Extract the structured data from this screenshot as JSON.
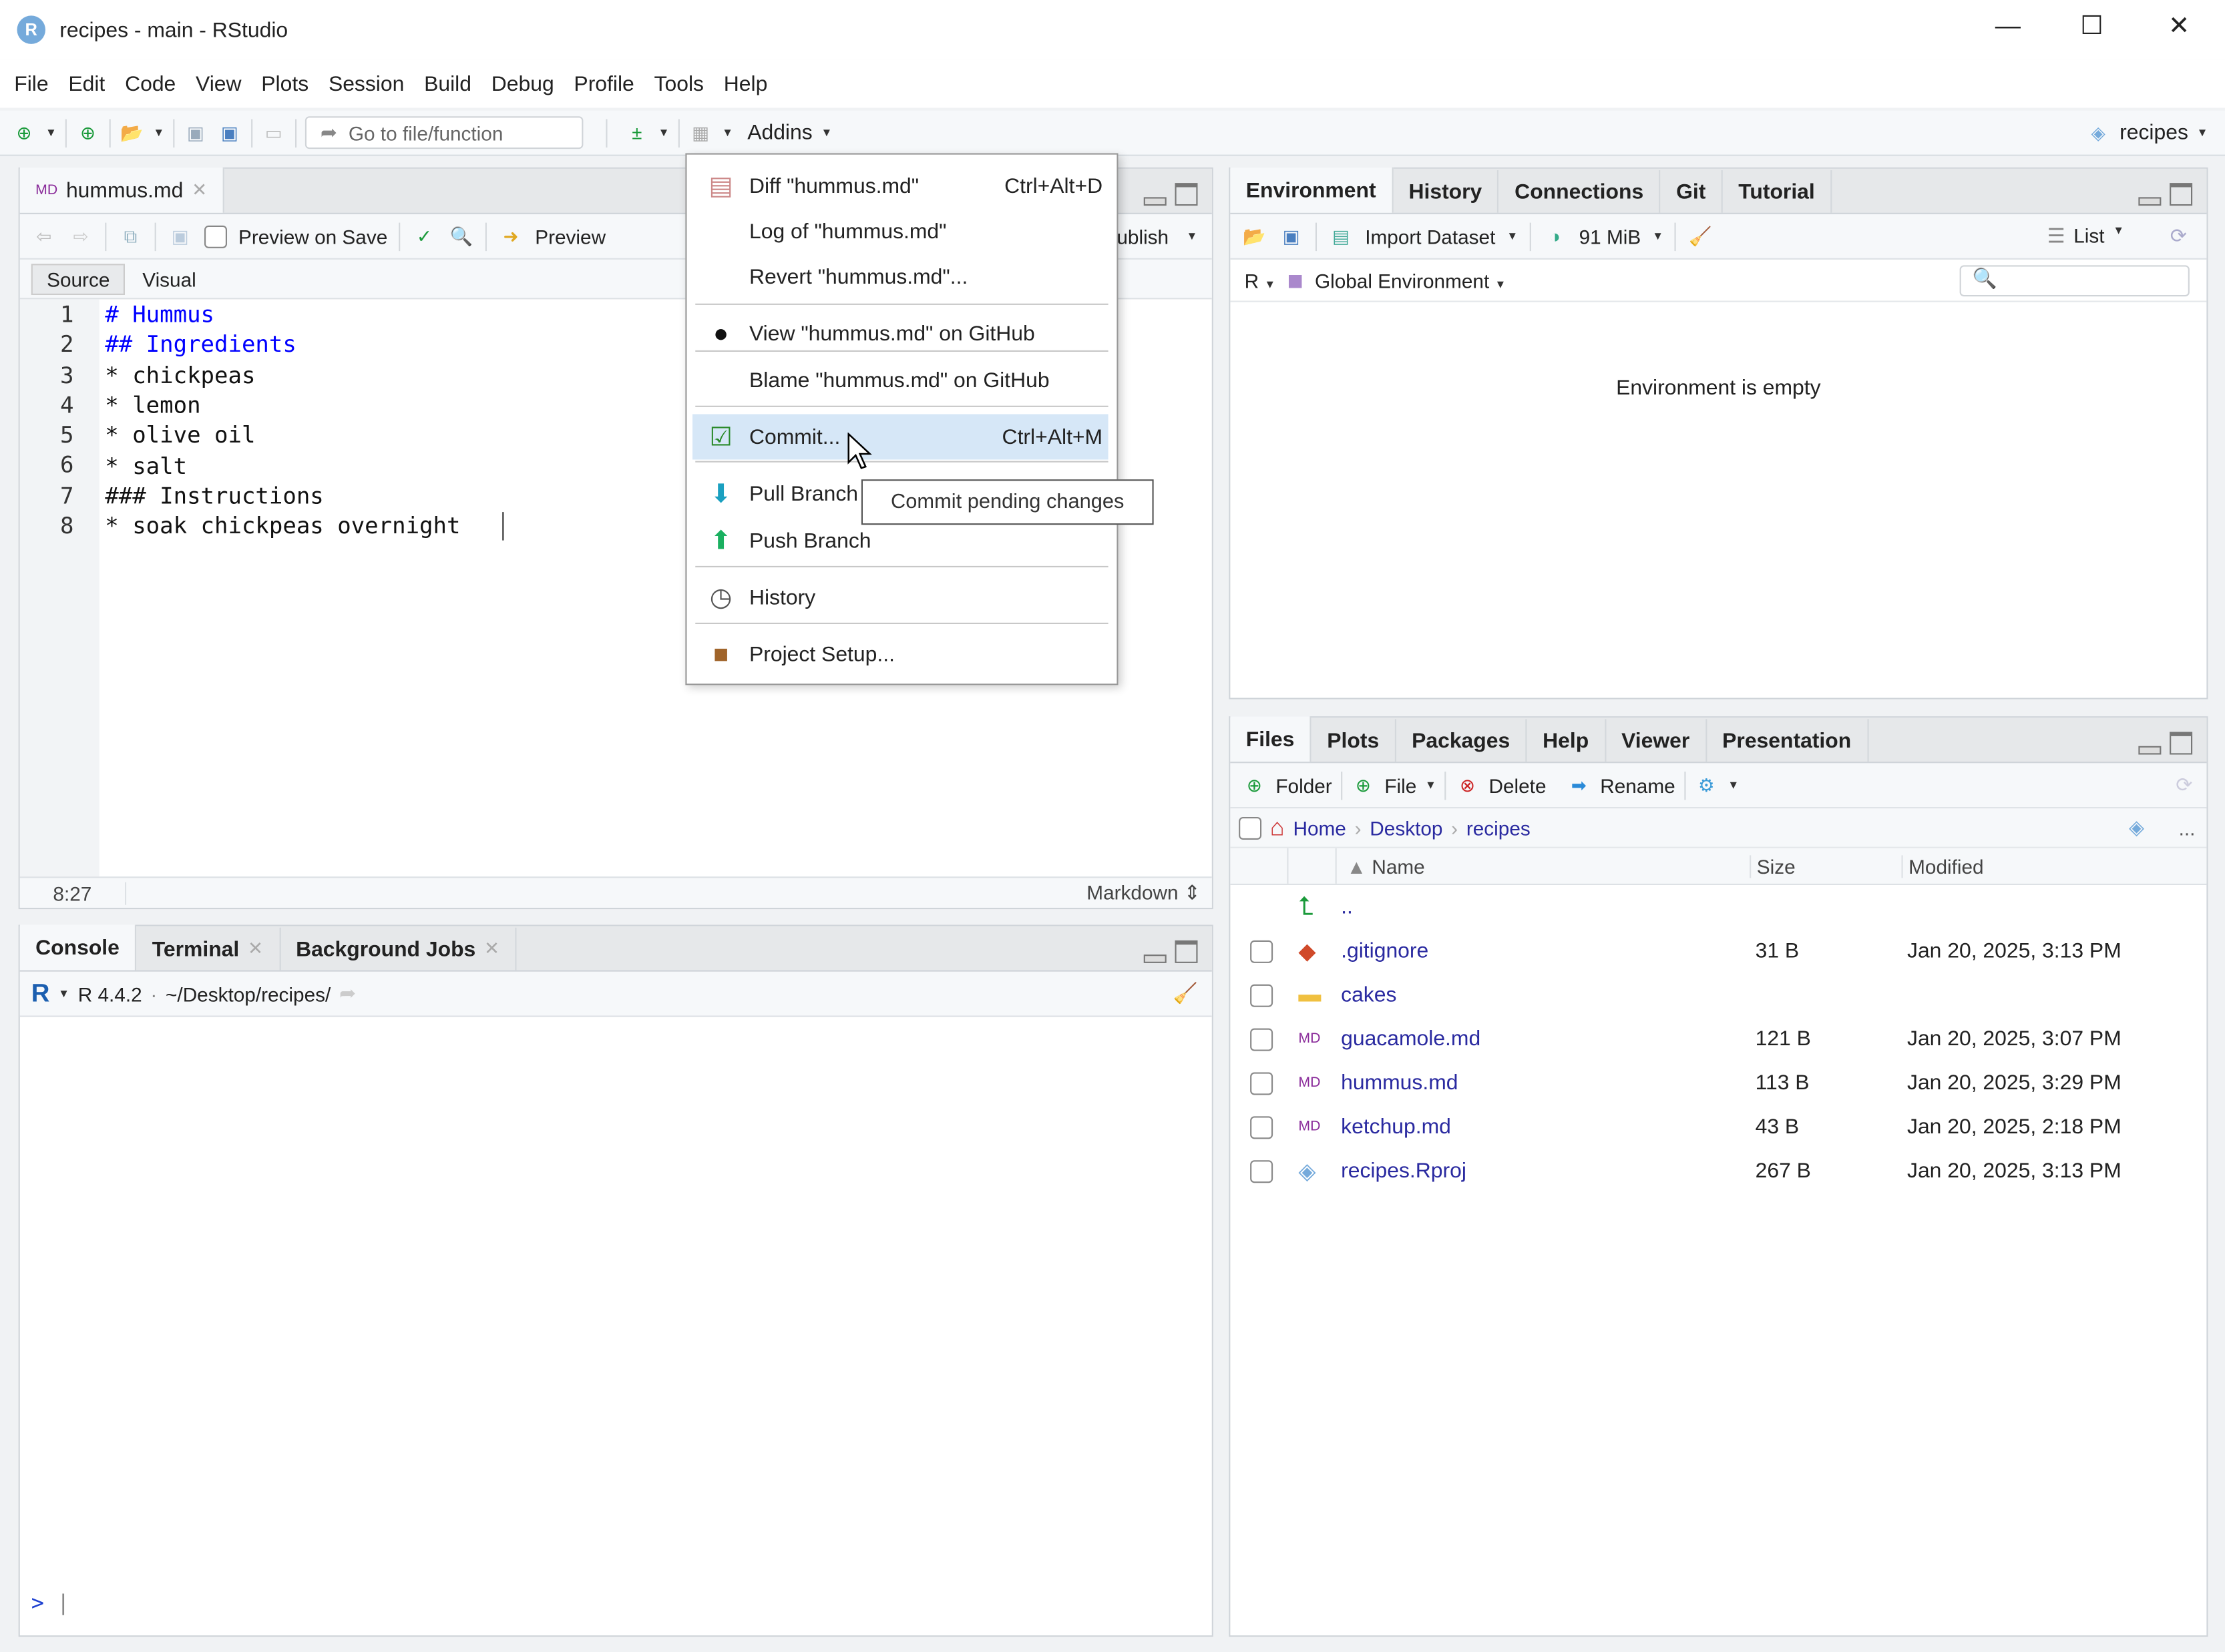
{
  "window": {
    "title": "recipes - main - RStudio",
    "minimize": "—",
    "maximize": "☐",
    "close": "✕"
  },
  "menubar": [
    "File",
    "Edit",
    "Code",
    "View",
    "Plots",
    "Session",
    "Build",
    "Debug",
    "Profile",
    "Tools",
    "Help"
  ],
  "toolbar": {
    "goto_placeholder": "Go to file/function",
    "addins": "Addins",
    "project": "recipes"
  },
  "editor": {
    "tab": "hummus.md",
    "preview_on_save": "Preview on Save",
    "preview": "Preview",
    "publish": "ublish",
    "source": "Source",
    "visual": "Visual",
    "lines": [
      {
        "n": "1",
        "t": "# Hummus",
        "h": true
      },
      {
        "n": "2",
        "t": "## Ingredients",
        "h": true
      },
      {
        "n": "3",
        "t": "* chickpeas"
      },
      {
        "n": "4",
        "t": "* lemon"
      },
      {
        "n": "5",
        "t": "* olive oil"
      },
      {
        "n": "6",
        "t": "* salt"
      },
      {
        "n": "7",
        "t": "### Instructions"
      },
      {
        "n": "8",
        "t": "* soak chickpeas overnight"
      }
    ],
    "position": "8:27",
    "mode": "Markdown"
  },
  "git_menu": {
    "items": [
      {
        "label": "Diff \"hummus.md\"",
        "shortcut": "Ctrl+Alt+D",
        "icon": "diff-icon"
      },
      {
        "label": "Log of \"hummus.md\"",
        "shortcut": "",
        "icon": ""
      },
      {
        "label": "Revert \"hummus.md\"...",
        "shortcut": "",
        "icon": ""
      },
      {
        "label": "View \"hummus.md\" on GitHub",
        "shortcut": "",
        "icon": "github-icon"
      },
      {
        "label": "Blame \"hummus.md\" on GitHub",
        "shortcut": "",
        "icon": ""
      },
      {
        "label": "Commit...",
        "shortcut": "Ctrl+Alt+M",
        "icon": "commit-icon",
        "highlighted": true
      },
      {
        "label": "Pull Branch",
        "shortcut": "",
        "icon": "pull-arrow-icon"
      },
      {
        "label": "Push Branch",
        "shortcut": "",
        "icon": "push-arrow-icon"
      },
      {
        "label": "History",
        "shortcut": "",
        "icon": "clock-icon"
      },
      {
        "label": "Project Setup...",
        "shortcut": "",
        "icon": "box-icon"
      }
    ],
    "tooltip": "Commit pending changes"
  },
  "console": {
    "tabs": [
      "Console",
      "Terminal",
      "Background Jobs"
    ],
    "version": "R 4.4.2",
    "path": "~/Desktop/recipes/",
    "prompt": ">"
  },
  "environment": {
    "tabs": [
      "Environment",
      "History",
      "Connections",
      "Git",
      "Tutorial"
    ],
    "import": "Import Dataset",
    "memory": "91 MiB",
    "view": "List",
    "lang": "R",
    "scope": "Global Environment",
    "empty": "Environment is empty",
    "search_placeholder": ""
  },
  "files": {
    "tabs": [
      "Files",
      "Plots",
      "Packages",
      "Help",
      "Viewer",
      "Presentation"
    ],
    "actions": {
      "folder": "Folder",
      "file": "File",
      "delete": "Delete",
      "rename": "Rename"
    },
    "breadcrumb": [
      "Home",
      "Desktop",
      "recipes"
    ],
    "more": "...",
    "columns": {
      "name": "Name",
      "size": "Size",
      "modified": "Modified"
    },
    "parent": "..",
    "rows": [
      {
        "name": ".gitignore",
        "size": "31 B",
        "modified": "Jan 20, 2025, 3:13 PM",
        "icon": "gitignore-icon"
      },
      {
        "name": "cakes",
        "size": "",
        "modified": "",
        "icon": "folder-icon"
      },
      {
        "name": "guacamole.md",
        "size": "121 B",
        "modified": "Jan 20, 2025, 3:07 PM",
        "icon": "markdown-file-icon"
      },
      {
        "name": "hummus.md",
        "size": "113 B",
        "modified": "Jan 20, 2025, 3:29 PM",
        "icon": "markdown-file-icon"
      },
      {
        "name": "ketchup.md",
        "size": "43 B",
        "modified": "Jan 20, 2025, 2:18 PM",
        "icon": "markdown-file-icon"
      },
      {
        "name": "recipes.Rproj",
        "size": "267 B",
        "modified": "Jan 20, 2025, 3:13 PM",
        "icon": "rproj-icon"
      }
    ]
  },
  "colors": {
    "heading": "#0000ff",
    "highlight": "#d6e7f7",
    "link": "#2a2aa0",
    "accent": "#75aadb"
  }
}
